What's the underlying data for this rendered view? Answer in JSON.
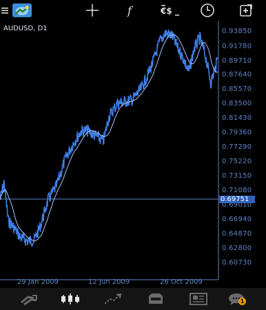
{
  "toolbar": {
    "menu_icon": "hamburger-menu-icon",
    "app_icon": "metatrader-app-icon",
    "crosshair_icon": "crosshair-icon",
    "indicators_icon": "indicators-f-icon",
    "symbols_icon": "symbols-icon",
    "timeframe_icon": "clock-icon",
    "add_icon": "new-order-icon"
  },
  "chart": {
    "symbol_label": "AUDUSD, D1",
    "current_price": "0.69751",
    "price_labels": [
      "0.93850",
      "0.91780",
      "0.89710",
      "0.87640",
      "0.85570",
      "0.83500",
      "0.81430",
      "0.79360",
      "0.77290",
      "0.75220",
      "0.73150",
      "0.71080",
      "0.69010",
      "0.66940",
      "0.64870",
      "0.62800",
      "0.60730"
    ],
    "date_labels": [
      "29 Jan 2009",
      "12 Jun 2009",
      "26 Oct 2009"
    ],
    "line_color": "#3f7fe6",
    "ma_color": "#a9c6ff"
  },
  "bottom_nav": {
    "items": [
      "quotes-icon",
      "chart-candles-icon",
      "trade-icon",
      "history-icon",
      "news-icon",
      "messages-icon"
    ],
    "active": "chart-candles-icon",
    "messages_badge": "1",
    "badge_color": "#e59a12"
  }
}
